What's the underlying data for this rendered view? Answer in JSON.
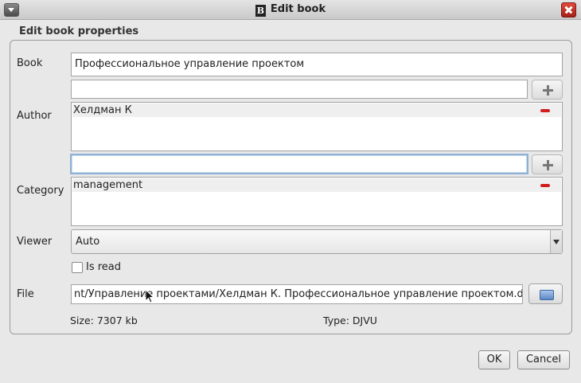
{
  "window": {
    "title": "Edit book"
  },
  "group": {
    "title": "Edit book properties"
  },
  "book": {
    "label": "Book",
    "value": "Профессиональное управление проектом"
  },
  "author": {
    "label": "Author",
    "input_value": "",
    "items": [
      {
        "name": "Хелдман К"
      }
    ]
  },
  "category": {
    "label": "Category",
    "input_value": "",
    "items": [
      {
        "name": "management"
      }
    ]
  },
  "viewer": {
    "label": "Viewer",
    "selected": "Auto"
  },
  "is_read": {
    "label": "Is read",
    "checked": false
  },
  "file": {
    "label": "File",
    "value": "nt/Управление проектами/Хелдман К. Профессиональное управление проектом.djvu"
  },
  "info": {
    "size": "Size: 7307 kb",
    "type": "Type: DJVU"
  },
  "buttons": {
    "ok": "OK",
    "cancel": "Cancel"
  },
  "icons": {
    "window_menu": "chevron-down-icon",
    "app": "app-logo-icon",
    "close": "close-icon",
    "add": "plus-icon",
    "remove": "minus-icon",
    "browse": "folder-icon"
  },
  "colors": {
    "remove": "#d21c1c",
    "close": "#c8372b",
    "focus": "#8fb1d6"
  }
}
